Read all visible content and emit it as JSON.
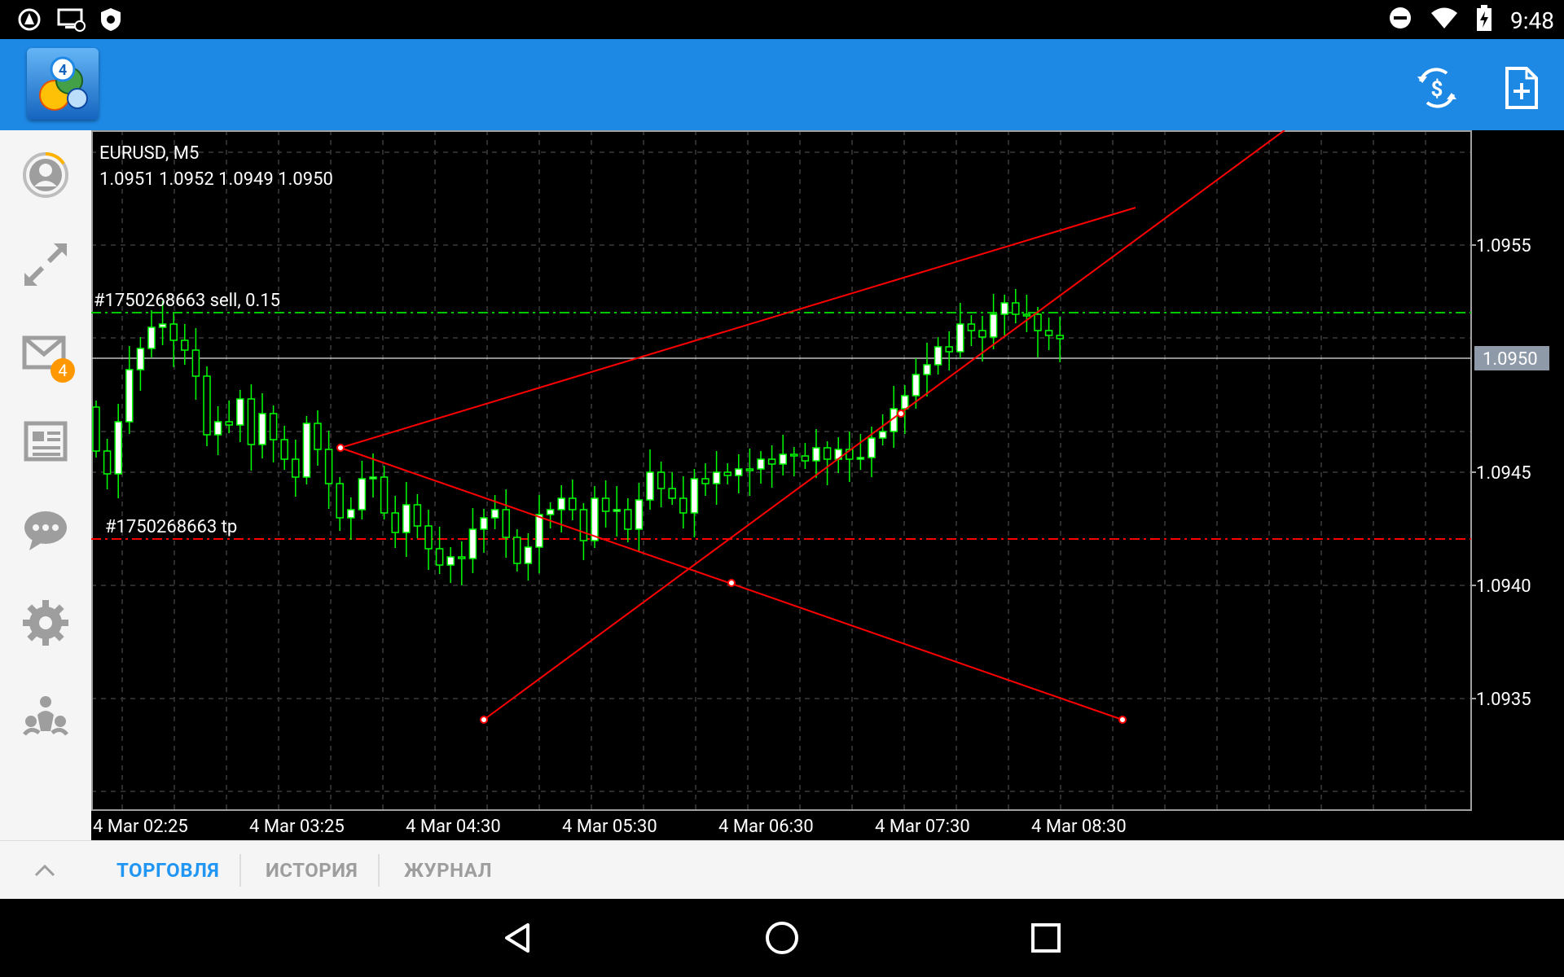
{
  "status_bar": {
    "time": "9:48"
  },
  "sidebar": {
    "mail_badge": "4"
  },
  "chart": {
    "symbol_timeframe": "EURUSD, M5",
    "ohlc": "1.0951 1.0952 1.0949 1.0950",
    "order_label": "#1750268663 sell, 0.15",
    "tp_label": "#1750268663 tp",
    "current_price": "1.0950",
    "price_axis": [
      "1.0955",
      "1.0945",
      "1.0940",
      "1.0935"
    ],
    "time_axis": [
      "4 Mar 02:25",
      "4 Mar 03:25",
      "4 Mar 04:30",
      "4 Mar 05:30",
      "4 Mar 06:30",
      "4 Mar 07:30",
      "4 Mar 08:30"
    ],
    "colors": {
      "bull": "#ffffff",
      "bear": "#000000",
      "wick": "#00ff00",
      "trendlines": "#ff0000",
      "sell_line": "#00c800",
      "tp_line": "#ff0000",
      "bid_line": "#c0c0c0"
    }
  },
  "tabs": {
    "trade": "ТОРГОВЛЯ",
    "history": "ИСТОРИЯ",
    "journal": "ЖУРНАЛ"
  }
}
